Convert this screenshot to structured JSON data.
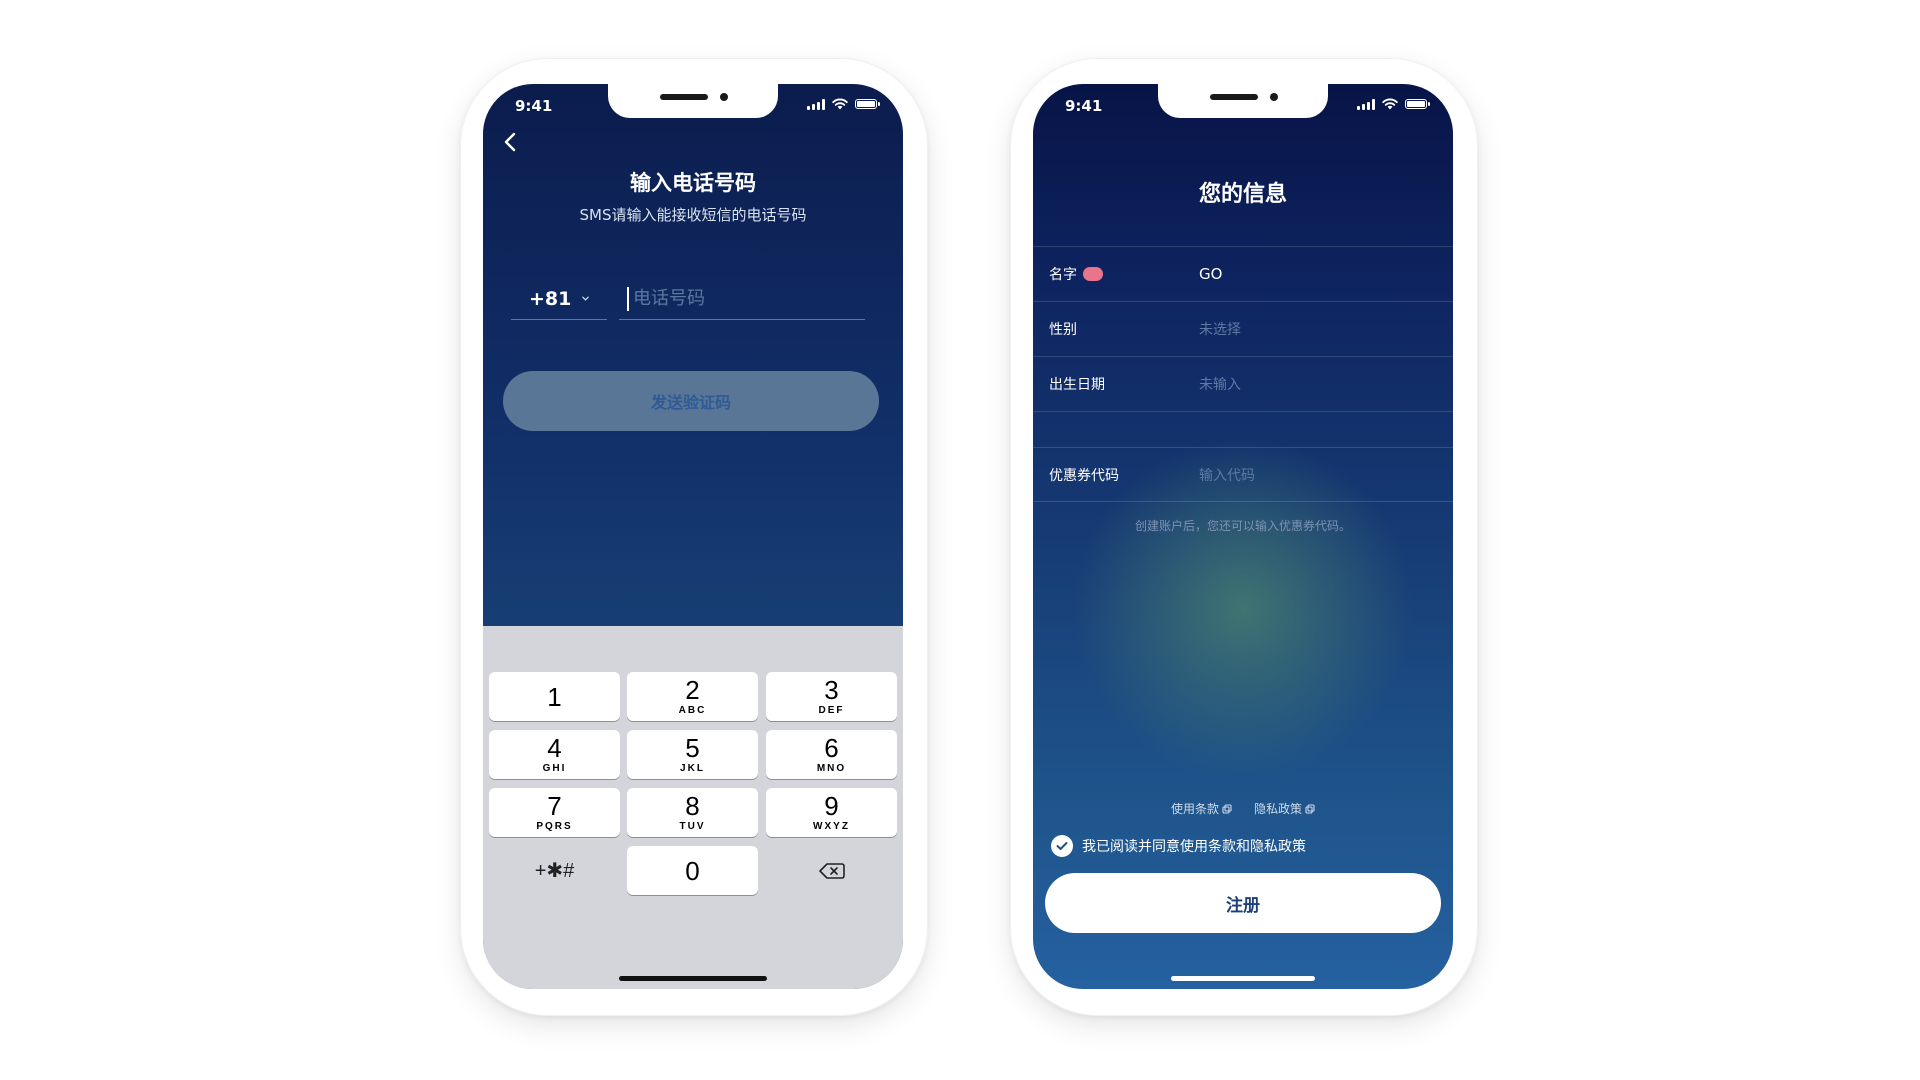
{
  "left_screen": {
    "status": {
      "time": "9:41"
    },
    "title": "输入电话号码",
    "subtitle": "SMS请输入能接收短信的电话号码",
    "country_code": "+81",
    "phone_placeholder": "电话号码",
    "send_button": "发送验证码",
    "keypad": [
      {
        "digit": "1",
        "letters": ""
      },
      {
        "digit": "2",
        "letters": "ABC"
      },
      {
        "digit": "3",
        "letters": "DEF"
      },
      {
        "digit": "4",
        "letters": "GHI"
      },
      {
        "digit": "5",
        "letters": "JKL"
      },
      {
        "digit": "6",
        "letters": "MNO"
      },
      {
        "digit": "7",
        "letters": "PQRS"
      },
      {
        "digit": "8",
        "letters": "TUV"
      },
      {
        "digit": "9",
        "letters": "WXYZ"
      },
      {
        "digit": "0",
        "letters": ""
      }
    ],
    "symbols_key": "+✱#"
  },
  "right_screen": {
    "status": {
      "time": "9:41"
    },
    "title": "您的信息",
    "fields": {
      "name": {
        "label": "名字",
        "value": "GO"
      },
      "gender": {
        "label": "性别",
        "placeholder": "未选择"
      },
      "birthday": {
        "label": "出生日期",
        "placeholder": "未输入"
      },
      "coupon": {
        "label": "优惠券代码",
        "placeholder": "输入代码"
      }
    },
    "coupon_note": "创建账户后，您还可以输入优惠券代码。",
    "terms_link": "使用条款",
    "privacy_link": "隐私政策",
    "agree_text": "我已阅读并同意使用条款和隐私政策",
    "agree_checked": true,
    "register_button": "注册"
  },
  "colors": {
    "screen_top": "#0b1c4d",
    "screen_bottom": "#24546f",
    "keyboard_bg": "#d3d5db",
    "required_badge": "#e9758b",
    "button_text": "#1c3f7a"
  }
}
